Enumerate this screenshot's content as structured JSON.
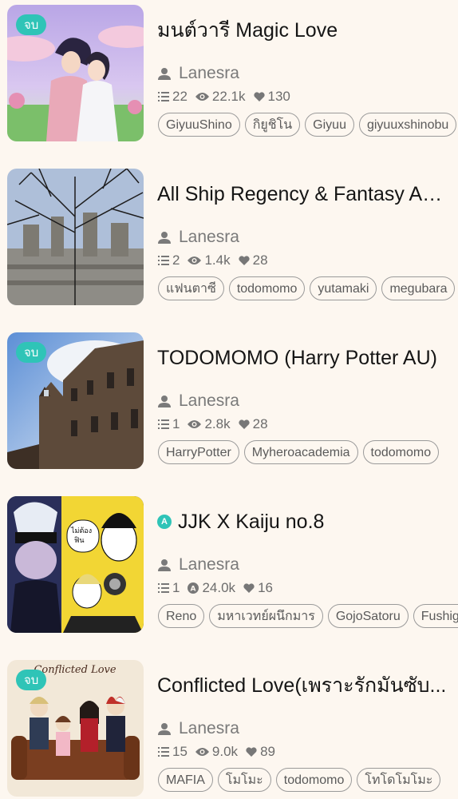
{
  "stories": [
    {
      "title": "มนต์วารี Magic Love",
      "completed": true,
      "badge_label": "จบ",
      "author": "Lanesra",
      "chapters": "22",
      "views": "22.1k",
      "likes": "130",
      "tags": [
        "GiyuuShino",
        "กิยูชิโน",
        "Giyuu",
        "giyuuxshinobu"
      ]
    },
    {
      "title": "All Ship Regency & Fantasy AU ...",
      "completed": false,
      "author": "Lanesra",
      "chapters": "2",
      "views": "1.4k",
      "likes": "28",
      "tags": [
        "แฟนตาซี",
        "todomomo",
        "yutamaki",
        "megubara"
      ]
    },
    {
      "title": "TODOMOMO (Harry Potter AU)",
      "completed": true,
      "badge_label": "จบ",
      "author": "Lanesra",
      "chapters": "1",
      "views": "2.8k",
      "likes": "28",
      "tags": [
        "HarryPotter",
        "Myheroacademia",
        "todomomo"
      ]
    },
    {
      "title": "JJK X Kaiju no.8",
      "completed": false,
      "author": "Lanesra",
      "chapters": "1",
      "views": "24.0k",
      "likes": "16",
      "title_badge": "A",
      "tags": [
        "Reno",
        "มหาเวทย์ผนึกมาร",
        "GojoSatoru",
        "Fushiguro"
      ]
    },
    {
      "title": "Conflicted Love(เพราะรักมันซับ...",
      "completed": true,
      "badge_label": "จบ",
      "author": "Lanesra",
      "chapters": "15",
      "views": "9.0k",
      "likes": "89",
      "tags": [
        "MAFIA",
        "โมโมะ",
        "todomomo",
        "โทโดโมโมะ"
      ]
    }
  ],
  "colors": {
    "background": "#fdf7f0",
    "accent": "#2fc4b7",
    "title": "#151515",
    "meta": "#6c6c6c"
  },
  "icons": {
    "author": "person-icon",
    "chapters": "list-icon",
    "views": "eye-icon",
    "likes": "heart-icon",
    "adult_views": "a-circle-icon"
  }
}
